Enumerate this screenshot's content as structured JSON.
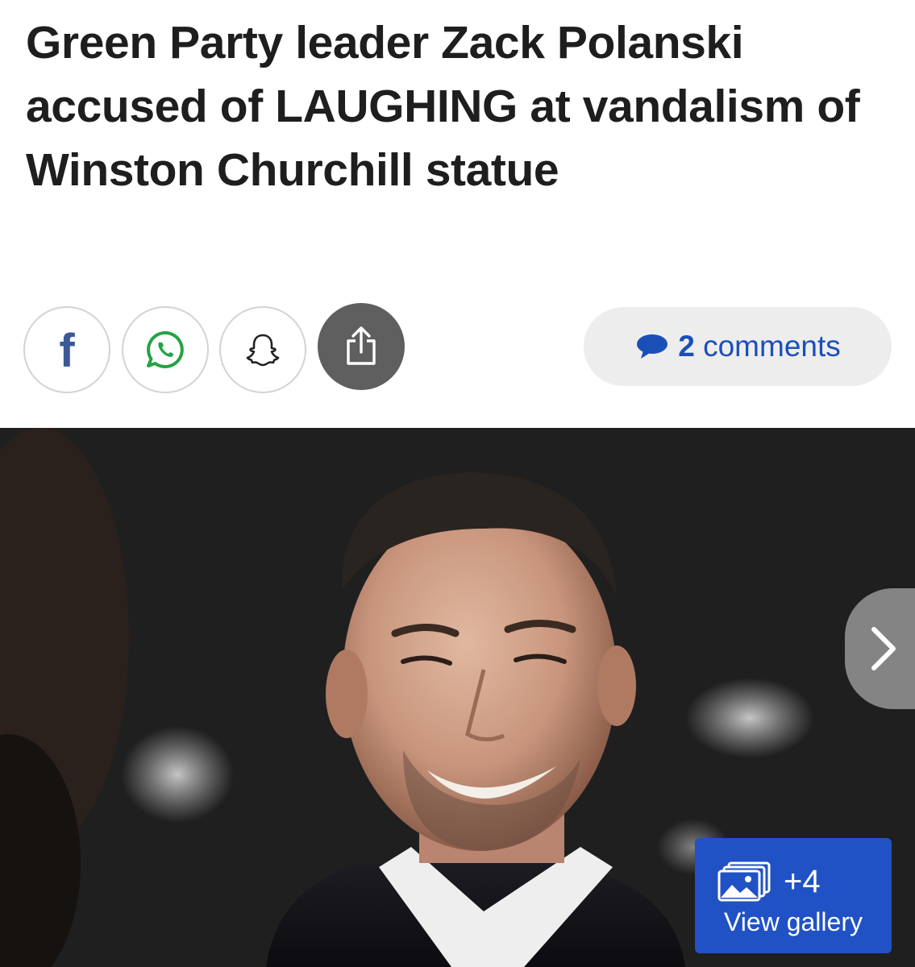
{
  "article": {
    "headline": "Green Party leader Zack Polanski accused of LAUGHING at vandalism of Winston Churchill statue"
  },
  "share": {
    "facebook": {
      "glyph": "f",
      "icon": "facebook-icon",
      "color": "#3b5998"
    },
    "whatsapp": {
      "icon": "whatsapp-icon",
      "color": "#25a244"
    },
    "snapchat": {
      "icon": "snapchat-icon"
    },
    "native_share": {
      "icon": "share-icon",
      "bg": "#5f5f5f"
    }
  },
  "comments": {
    "count": "2",
    "label": "comments",
    "icon": "comment-bubble-icon",
    "color": "#1b4fb8"
  },
  "hero_image": {
    "next_icon": "chevron-right-icon",
    "gallery": {
      "extra_count": "+4",
      "label": "View gallery",
      "icon": "gallery-icon",
      "bg": "#2052c6"
    }
  }
}
